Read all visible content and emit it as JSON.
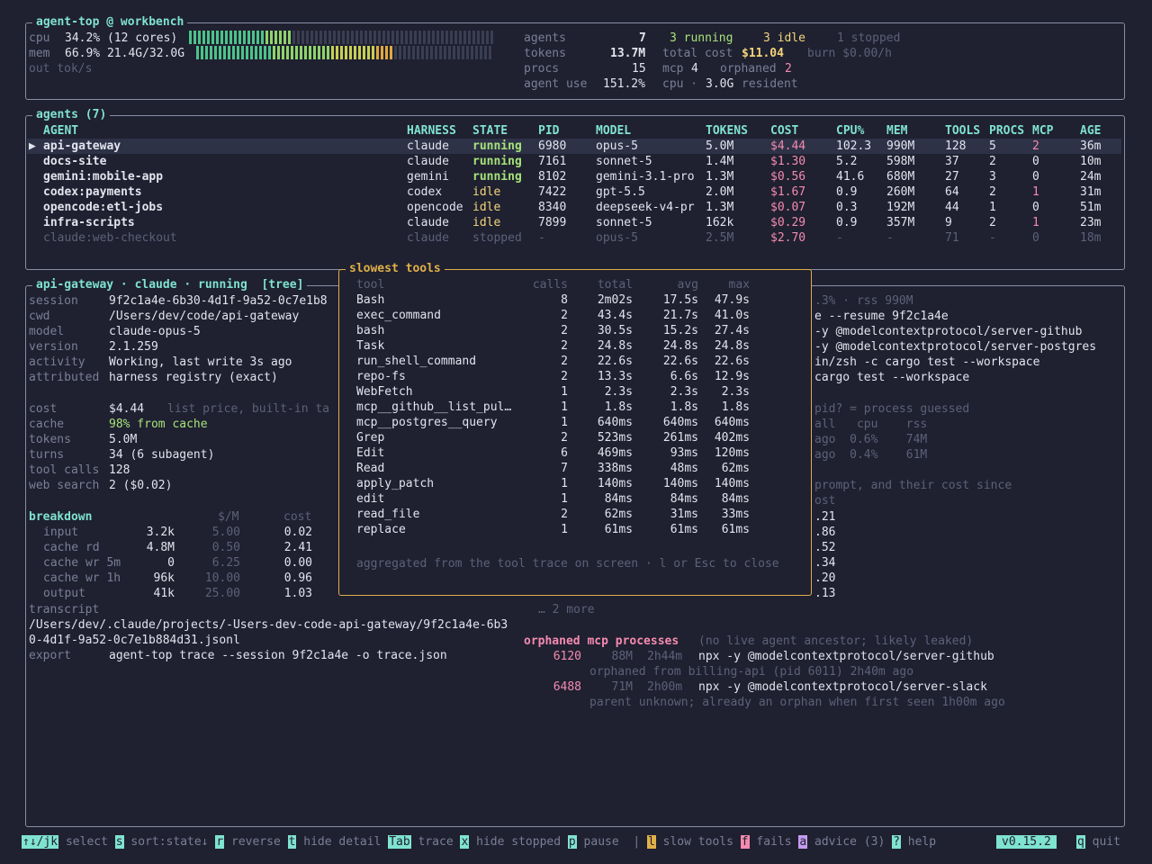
{
  "header": {
    "title": "agent-top @ workbench",
    "cpu_label": "cpu",
    "cpu_value": "34.2% (12 cores)",
    "cpu_fraction": 0.342,
    "mem_label": "mem",
    "mem_value": "66.9% 21.4G/32.0G",
    "mem_fraction": 0.669,
    "out_label": "out tok/s",
    "agents_label": "agents",
    "agents_value": "7",
    "agents_running": "3 running",
    "agents_idle": "3 idle",
    "agents_stopped": "1 stopped",
    "tokens_label": "tokens",
    "tokens_value": "13.7M",
    "total_cost_label": "total cost",
    "total_cost_value": "$11.04",
    "burn_label": "burn $0.00/h",
    "procs_label": "procs",
    "procs_value": "15",
    "mcp_label": "mcp",
    "mcp_value": "4",
    "orphaned_label": "orphaned",
    "orphaned_value": "2",
    "agent_use_label": "agent use",
    "agent_use_value": "151.2%",
    "cpu_dot_label": "cpu ·",
    "resident_value": "3.0G",
    "resident_label": "resident",
    "colors": {
      "accent": "#7fe3d0",
      "running": "#a6e37a",
      "idle": "#f2d67a",
      "cost": "#f58bb0"
    }
  },
  "agents_panel": {
    "title": "agents (7)",
    "columns": [
      "AGENT",
      "HARNESS",
      "STATE",
      "PID",
      "MODEL",
      "TOKENS",
      "COST",
      "CPU%",
      "MEM",
      "TOOLS",
      "PROCS",
      "MCP",
      "AGE"
    ],
    "rows": [
      {
        "marker": "▶",
        "agent": "api-gateway",
        "harness": "claude",
        "state": "running",
        "pid": "6980",
        "model": "opus-5",
        "tokens": "5.0M",
        "cost": "$4.44",
        "cpu": "102.3",
        "mem": "990M",
        "tools": "128",
        "procs": "5",
        "mcp": "2",
        "age": "36m"
      },
      {
        "marker": "",
        "agent": "docs-site",
        "harness": "claude",
        "state": "running",
        "pid": "7161",
        "model": "sonnet-5",
        "tokens": "1.4M",
        "cost": "$1.30",
        "cpu": "5.2",
        "mem": "598M",
        "tools": "37",
        "procs": "2",
        "mcp": "0",
        "age": "10m"
      },
      {
        "marker": "",
        "agent": "gemini:mobile-app",
        "harness": "gemini",
        "state": "running",
        "pid": "8102",
        "model": "gemini-3.1-pro",
        "tokens": "1.3M",
        "cost": "$0.56",
        "cpu": "41.6",
        "mem": "680M",
        "tools": "27",
        "procs": "3",
        "mcp": "0",
        "age": "24m"
      },
      {
        "marker": "",
        "agent": "codex:payments",
        "harness": "codex",
        "state": "idle",
        "pid": "7422",
        "model": "gpt-5.5",
        "tokens": "2.0M",
        "cost": "$1.67",
        "cpu": "0.9",
        "mem": "260M",
        "tools": "64",
        "procs": "2",
        "mcp": "1",
        "age": "31m"
      },
      {
        "marker": "",
        "agent": "opencode:etl-jobs",
        "harness": "opencode",
        "state": "idle",
        "pid": "8340",
        "model": "deepseek-v4-pr",
        "tokens": "1.3M",
        "cost": "$0.07",
        "cpu": "0.3",
        "mem": "192M",
        "tools": "44",
        "procs": "1",
        "mcp": "0",
        "age": "51m"
      },
      {
        "marker": "",
        "agent": "infra-scripts",
        "harness": "claude",
        "state": "idle",
        "pid": "7899",
        "model": "sonnet-5",
        "tokens": "162k",
        "cost": "$0.29",
        "cpu": "0.9",
        "mem": "357M",
        "tools": "9",
        "procs": "2",
        "mcp": "1",
        "age": "23m"
      },
      {
        "marker": "",
        "agent": "claude:web-checkout",
        "harness": "claude",
        "state": "stopped",
        "pid": "-",
        "model": "opus-5",
        "tokens": "2.5M",
        "cost": "$2.70",
        "cpu": "-",
        "mem": "-",
        "tools": "71",
        "procs": "-",
        "mcp": "0",
        "age": "18m"
      }
    ]
  },
  "detail": {
    "title": "api-gateway · claude · running  [tree]",
    "fields": [
      {
        "k": "session",
        "v": "9f2c1a4e-6b30-4d1f-9a52-0c7e1b8"
      },
      {
        "k": "cwd",
        "v": "/Users/dev/code/api-gateway"
      },
      {
        "k": "model",
        "v": "claude-opus-5"
      },
      {
        "k": "version",
        "v": "2.1.259"
      },
      {
        "k": "activity",
        "v": "Working, last write 3s ago"
      },
      {
        "k": "attributed",
        "v": "harness registry (exact)"
      }
    ],
    "cost_label": "cost",
    "cost_value": "$4.44",
    "cost_note": "list price, built-in ta",
    "cache_label": "cache",
    "cache_value": "98% from cache",
    "tokens_label": "tokens",
    "tokens_value": "5.0M",
    "turns_label": "turns",
    "turns_value": "34 (6 subagent)",
    "toolcalls_label": "tool calls",
    "toolcalls_value": "128",
    "websearch_label": "web search",
    "websearch_value": "2 ($0.02)",
    "breakdown_title": "breakdown",
    "breakdown_col_rate": "$/M",
    "breakdown_col_cost": "cost",
    "breakdown": [
      {
        "name": "input",
        "qty": "3.2k",
        "rate": "5.00",
        "cost": "0.02"
      },
      {
        "name": "cache rd",
        "qty": "4.8M",
        "rate": "0.50",
        "cost": "2.41"
      },
      {
        "name": "cache wr 5m",
        "qty": "0",
        "rate": "6.25",
        "cost": "0.00"
      },
      {
        "name": "cache wr 1h",
        "qty": "96k",
        "rate": "10.00",
        "cost": "0.96"
      },
      {
        "name": "output",
        "qty": "41k",
        "rate": "25.00",
        "cost": "1.03"
      }
    ],
    "transcript_label": "transcript",
    "transcript_line1": "/Users/dev/.claude/projects/-Users-dev-code-api-gateway/9f2c1a4e-6b3",
    "transcript_line2": "0-4d1f-9a52-0c7e1b884d31.jsonl",
    "export_label": "export",
    "export_value": "agent-top trace --session 9f2c1a4e -o trace.json",
    "right_fragments": [
      ".3% · rss 990M",
      "e --resume 9f2c1a4e",
      "-y @modelcontextprotocol/server-github",
      "-y @modelcontextprotocol/server-postgres",
      "in/zsh -c cargo test --workspace",
      "cargo test --workspace"
    ],
    "right_proc_note": "pid? = process guessed",
    "right_proc_header": "all   cpu    rss",
    "right_proc_rows": [
      "ago  0.6%    74M",
      "ago  0.4%    61M"
    ],
    "right_prompt_line": "prompt, and their cost since",
    "right_cost_header": "ost",
    "right_costs": [
      ".21",
      ".86",
      ".52",
      ".34",
      ".20",
      ".13"
    ],
    "more_label": "… 2 more",
    "orphaned_title": "orphaned mcp processes",
    "orphaned_note": "(no live agent ancestor; likely leaked)",
    "orphans": [
      {
        "pid": "6120",
        "rss": "88M",
        "age": "2h44m",
        "cmd": "npx -y @modelcontextprotocol/server-github",
        "origin": "orphaned from billing-api (pid 6011) 2h40m ago"
      },
      {
        "pid": "6488",
        "rss": "71M",
        "age": "2h00m",
        "cmd": "npx -y @modelcontextprotocol/server-slack",
        "origin": "parent unknown; already an orphan when first seen 1h00m ago"
      }
    ]
  },
  "popup": {
    "title": "slowest tools",
    "columns": [
      "tool",
      "calls",
      "total",
      "avg",
      "max"
    ],
    "rows": [
      {
        "tool": "Bash",
        "calls": "8",
        "total": "2m02s",
        "avg": "17.5s",
        "max": "47.9s"
      },
      {
        "tool": "exec_command",
        "calls": "2",
        "total": "43.4s",
        "avg": "21.7s",
        "max": "41.0s"
      },
      {
        "tool": "bash",
        "calls": "2",
        "total": "30.5s",
        "avg": "15.2s",
        "max": "27.4s"
      },
      {
        "tool": "Task",
        "calls": "2",
        "total": "24.8s",
        "avg": "24.8s",
        "max": "24.8s"
      },
      {
        "tool": "run_shell_command",
        "calls": "2",
        "total": "22.6s",
        "avg": "22.6s",
        "max": "22.6s"
      },
      {
        "tool": "repo-fs",
        "calls": "2",
        "total": "13.3s",
        "avg": "6.6s",
        "max": "12.9s"
      },
      {
        "tool": "WebFetch",
        "calls": "1",
        "total": "2.3s",
        "avg": "2.3s",
        "max": "2.3s"
      },
      {
        "tool": "mcp__github__list_pul…",
        "calls": "1",
        "total": "1.8s",
        "avg": "1.8s",
        "max": "1.8s"
      },
      {
        "tool": "mcp__postgres__query",
        "calls": "1",
        "total": "640ms",
        "avg": "640ms",
        "max": "640ms"
      },
      {
        "tool": "Grep",
        "calls": "2",
        "total": "523ms",
        "avg": "261ms",
        "max": "402ms"
      },
      {
        "tool": "Edit",
        "calls": "6",
        "total": "469ms",
        "avg": "93ms",
        "max": "120ms"
      },
      {
        "tool": "Read",
        "calls": "7",
        "total": "338ms",
        "avg": "48ms",
        "max": "62ms"
      },
      {
        "tool": "apply_patch",
        "calls": "1",
        "total": "140ms",
        "avg": "140ms",
        "max": "140ms"
      },
      {
        "tool": "edit",
        "calls": "1",
        "total": "84ms",
        "avg": "84ms",
        "max": "84ms"
      },
      {
        "tool": "read_file",
        "calls": "2",
        "total": "62ms",
        "avg": "31ms",
        "max": "33ms"
      },
      {
        "tool": "replace",
        "calls": "1",
        "total": "61ms",
        "avg": "61ms",
        "max": "61ms"
      }
    ],
    "footer": "aggregated from the tool trace on screen · l or Esc to close"
  },
  "footer": {
    "items": [
      {
        "key": "↑↓/jk",
        "label": "select",
        "style": "key"
      },
      {
        "key": "s",
        "label": "sort:state↓",
        "style": "key"
      },
      {
        "key": "r",
        "label": "reverse",
        "style": "key"
      },
      {
        "key": "t",
        "label": "hide detail",
        "style": "key"
      },
      {
        "key": "Tab",
        "label": "trace",
        "style": "key"
      },
      {
        "key": "x",
        "label": "hide stopped",
        "style": "key"
      },
      {
        "key": "p",
        "label": "pause",
        "style": "key"
      },
      {
        "key": "l",
        "label": "slow tools",
        "style": "key-o"
      },
      {
        "key": "f",
        "label": "fails",
        "style": "key-p"
      },
      {
        "key": "a",
        "label": "advice (3)",
        "style": "key-v"
      },
      {
        "key": "?",
        "label": "help",
        "style": "key"
      }
    ],
    "separator": "|",
    "version": "v0.15.2",
    "quit_key": "q",
    "quit_label": "quit"
  }
}
